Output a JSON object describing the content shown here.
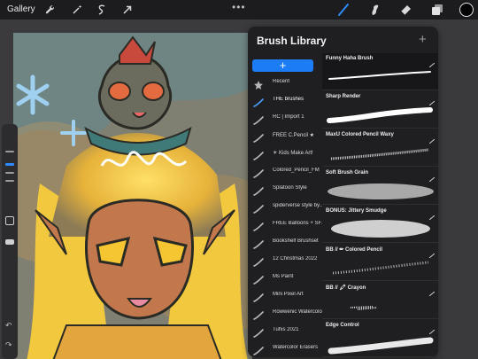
{
  "topbar": {
    "gallery_label": "Gallery",
    "menu_dots": "•••",
    "color_swatch": "#000000"
  },
  "library": {
    "title": "Brush Library",
    "add_symbol": "+",
    "header_plus": "+",
    "categories": [
      {
        "label": "Recent"
      },
      {
        "label": "THE brushes"
      },
      {
        "label": "RC | Import 1"
      },
      {
        "label": "FREE C.Pencil ★"
      },
      {
        "label": "☀ Kids Make Art!"
      },
      {
        "label": "Colored_Pencil_FM"
      },
      {
        "label": "Splatoon Style"
      },
      {
        "label": "spiderverse style by..."
      },
      {
        "label": "FREE Balloons + SFX"
      },
      {
        "label": "Bookshelf Brushset"
      },
      {
        "label": "12 Christmas 2022"
      },
      {
        "label": "Ms Paint"
      },
      {
        "label": "Mini Pixel Art"
      },
      {
        "label": "Rowwenic Watercolor"
      },
      {
        "label": "Tuhis 2021"
      },
      {
        "label": "Watercolor Erasers"
      }
    ],
    "brushes": [
      {
        "name": "Funny Haha Brush"
      },
      {
        "name": "Sharp Render"
      },
      {
        "name": "MaxU Colored Pencil Waxy"
      },
      {
        "name": "Soft Brush Grain"
      },
      {
        "name": "BONUS: Jittery Smudge"
      },
      {
        "name": "BB // ✏ Colored Pencil"
      },
      {
        "name": "BB // 🖍 Crayon"
      },
      {
        "name": "Edge Control"
      }
    ]
  },
  "colors": {
    "accent": "#1b7cf5",
    "panel": "#1f1f21",
    "topbar": "#1c1c1e"
  }
}
